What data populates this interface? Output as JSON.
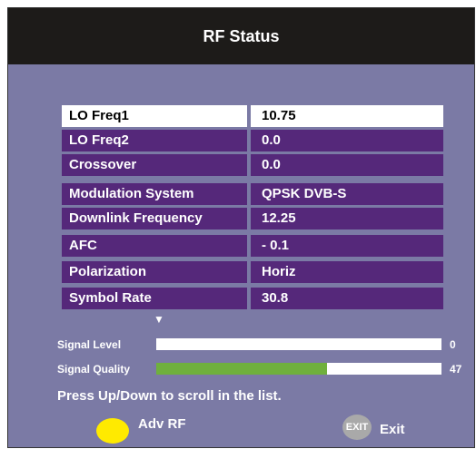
{
  "header": {
    "title": "RF Status"
  },
  "rows": [
    {
      "label": "LO Freq1",
      "value": "10.75"
    },
    {
      "label": "LO Freq2",
      "value": "0.0"
    },
    {
      "label": "Crossover",
      "value": "0.0"
    },
    {
      "label": "Modulation System",
      "value": "QPSK DVB-S"
    },
    {
      "label": "Downlink Frequency",
      "value": "12.25"
    },
    {
      "label": "AFC",
      "value": "- 0.1"
    },
    {
      "label": "Polarization",
      "value": "Horiz"
    },
    {
      "label": "Symbol Rate",
      "value": "30.8"
    }
  ],
  "scroll_indicator": "▼",
  "meters": {
    "signal_level": {
      "label": "Signal Level",
      "value": "0",
      "fill_fraction": 0.0
    },
    "signal_quality": {
      "label": "Signal Quality",
      "value": "47",
      "fill_fraction": 0.6
    }
  },
  "hint": "Press Up/Down to scroll in the list.",
  "footer": {
    "adv_rf_label": "Adv RF",
    "exit_icon_text": "EXIT",
    "exit_label": "Exit"
  },
  "colors": {
    "background": "#7b7aa5",
    "title_bar": "#1d1b19",
    "row": "#55287a",
    "selected_row": "#ffffff",
    "quality_fill": "#6fb03d",
    "yellow_button": "#ffea00"
  }
}
